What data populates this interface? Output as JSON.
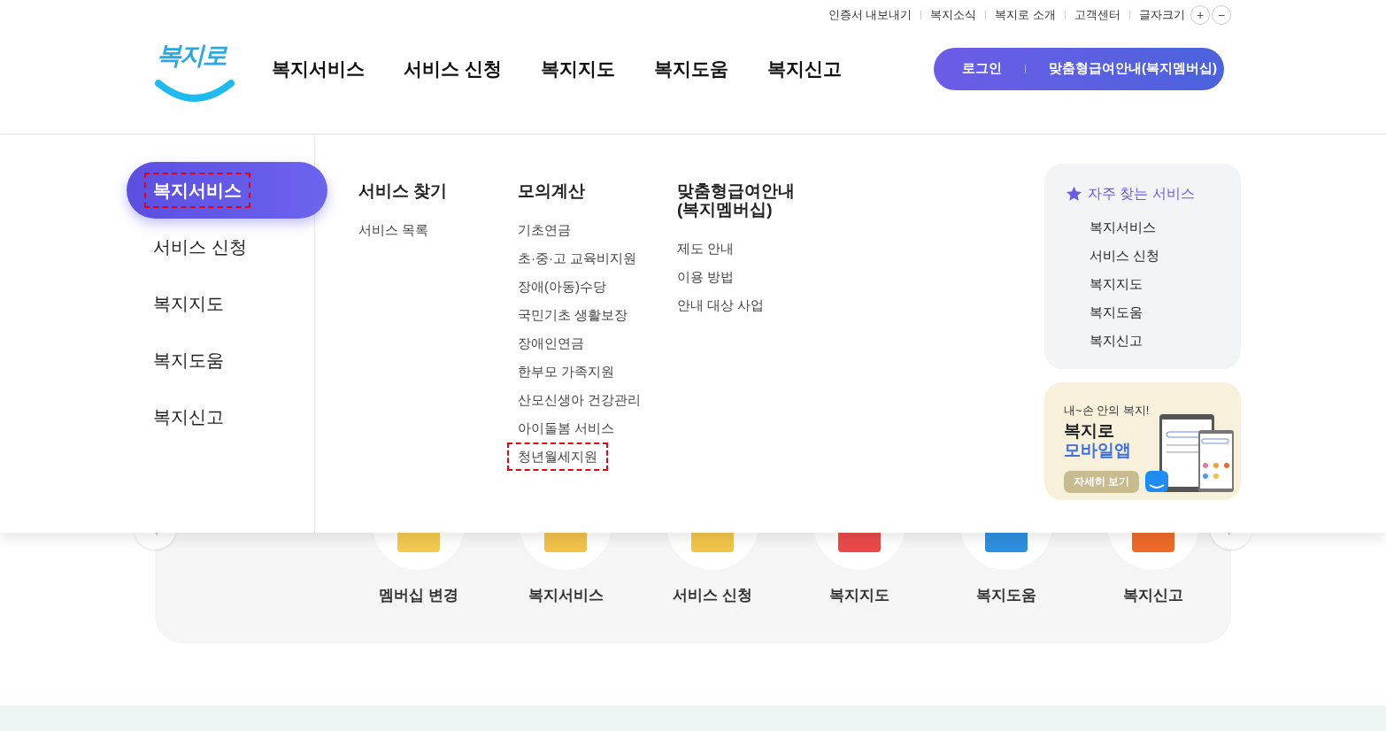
{
  "utility_links": [
    "인증서 내보내기",
    "복지소식",
    "복지로 소개",
    "고객센터"
  ],
  "font_size": {
    "label": "글자크기",
    "buttons": [
      "+",
      "−"
    ]
  },
  "logo": {
    "text": "복지로"
  },
  "main_nav": [
    "복지서비스",
    "서비스 신청",
    "복지지도",
    "복지도움",
    "복지신고"
  ],
  "header_button": {
    "login": "로그인",
    "membership": "맞춤형급여안내(복지멤버십)"
  },
  "mega_menu": {
    "sidebar": [
      {
        "label": "복지서비스",
        "selected": true,
        "highlighted": true
      },
      {
        "label": "서비스 신청",
        "selected": false,
        "highlighted": false
      },
      {
        "label": "복지지도",
        "selected": false,
        "highlighted": false
      },
      {
        "label": "복지도움",
        "selected": false,
        "highlighted": false
      },
      {
        "label": "복지신고",
        "selected": false,
        "highlighted": false
      }
    ],
    "columns": [
      {
        "heading": "서비스 찾기",
        "items": [
          {
            "label": "서비스 목록",
            "highlighted": false
          }
        ]
      },
      {
        "heading": "모의계산",
        "items": [
          {
            "label": "기초연금",
            "highlighted": false
          },
          {
            "label": "초·중·고 교육비지원",
            "highlighted": false
          },
          {
            "label": "장애(아동)수당",
            "highlighted": false
          },
          {
            "label": "국민기초 생활보장",
            "highlighted": false
          },
          {
            "label": "장애인연금",
            "highlighted": false
          },
          {
            "label": "한부모 가족지원",
            "highlighted": false
          },
          {
            "label": "산모신생아 건강관리",
            "highlighted": false
          },
          {
            "label": "아이돌봄 서비스",
            "highlighted": false
          },
          {
            "label": "청년월세지원",
            "highlighted": true
          }
        ]
      },
      {
        "heading": "맞춤형급여안내(복지멤버십)",
        "items": [
          {
            "label": "제도 안내",
            "highlighted": false
          },
          {
            "label": "이용 방법",
            "highlighted": false
          },
          {
            "label": "안내 대상 사업",
            "highlighted": false
          }
        ]
      }
    ],
    "frequent": {
      "title": "자주 찾는 서비스",
      "items": [
        "복지서비스",
        "서비스 신청",
        "복지지도",
        "복지도움",
        "복지신고"
      ]
    },
    "app_banner": {
      "tagline": "내~손 안의 복지!",
      "title_line1": "복지로",
      "title_line2": "모바일앱",
      "button": "자세히 보기"
    }
  },
  "quick_menu": [
    {
      "label": "멤버십 변경",
      "color": "#f3c94f"
    },
    {
      "label": "복지서비스",
      "color": "#f2c14a"
    },
    {
      "label": "서비스 신청",
      "color": "#f1c54a"
    },
    {
      "label": "복지지도",
      "color": "#ea4a4a"
    },
    {
      "label": "복지도움",
      "color": "#2f8fe0"
    },
    {
      "label": "복지신고",
      "color": "#ef6a2a"
    }
  ]
}
